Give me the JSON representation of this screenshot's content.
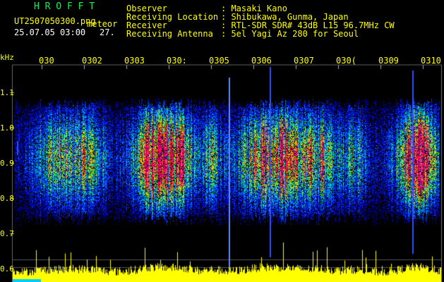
{
  "app": {
    "title": "H R O F F T",
    "filename": "UT2507050300.png",
    "suffix": "meteor",
    "datetime": "25.07.05 03:00",
    "count": "27."
  },
  "info": {
    "labels": [
      "Observer",
      "Receiving Location",
      "Receiver",
      "Receiving Antenna"
    ],
    "values": [
      ": Masaki Kano",
      ": Shibukawa, Gunma, Japan",
      ": RTL-SDR SDR# 43dB L15 96.7MHz CW",
      ": 5el Yagi Az 280 for Seoul"
    ]
  },
  "axis": {
    "y_unit": "kHz",
    "y_ticks": [
      "1.1",
      "1.0",
      "0.9",
      "0.8",
      "0.7",
      "0.6"
    ],
    "time_ticks": [
      "030",
      "0302",
      "0303",
      "030:",
      "0305",
      "0306",
      "0307",
      "030(",
      "0309",
      "0310"
    ]
  },
  "colors": {
    "background": "#000000",
    "label_yellow": "#ffff00",
    "title_green": "#00ff44",
    "noise_blue": "#0000cc",
    "signal_red": "#ff0066",
    "bottom_bar_yellow": "#ffff00"
  }
}
